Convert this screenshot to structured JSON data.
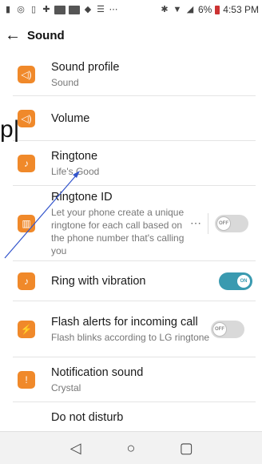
{
  "status_bar": {
    "battery": "6%",
    "time": "4:53 PM"
  },
  "app_bar": {
    "back_icon": "←",
    "title": "Sound"
  },
  "items": [
    {
      "title": "Sound profile",
      "subtitle": "Sound",
      "icon": "speaker-icon"
    },
    {
      "title": "Volume",
      "subtitle": "",
      "icon": "volume-icon"
    },
    {
      "title": "Ringtone",
      "subtitle": "Life's Good",
      "icon": "ringtone-icon"
    },
    {
      "title": "Ringtone ID",
      "subtitle": "Let your phone create a unique ringtone for each call based on the phone number that's calling you",
      "icon": "ringtone-id-icon",
      "toggle": "OFF"
    },
    {
      "title": "Ring with vibration",
      "subtitle": "",
      "icon": "vibration-icon",
      "toggle": "ON"
    },
    {
      "title": "Flash alerts for incoming call",
      "subtitle": "Flash blinks according to LG ringtone",
      "icon": "flash-icon",
      "toggle": "OFF"
    },
    {
      "title": "Notification sound",
      "subtitle": "Crystal",
      "icon": "notification-icon"
    },
    {
      "title": "Do not disturb",
      "subtitle": "",
      "icon": "dnd-icon"
    }
  ],
  "nav": {
    "back": "◁",
    "home": "○",
    "recents": "▢"
  },
  "overlay": {
    "partial_text": "p|"
  },
  "colors": {
    "accent": "#3a9ab0",
    "icon_bg": "#f0892a"
  }
}
